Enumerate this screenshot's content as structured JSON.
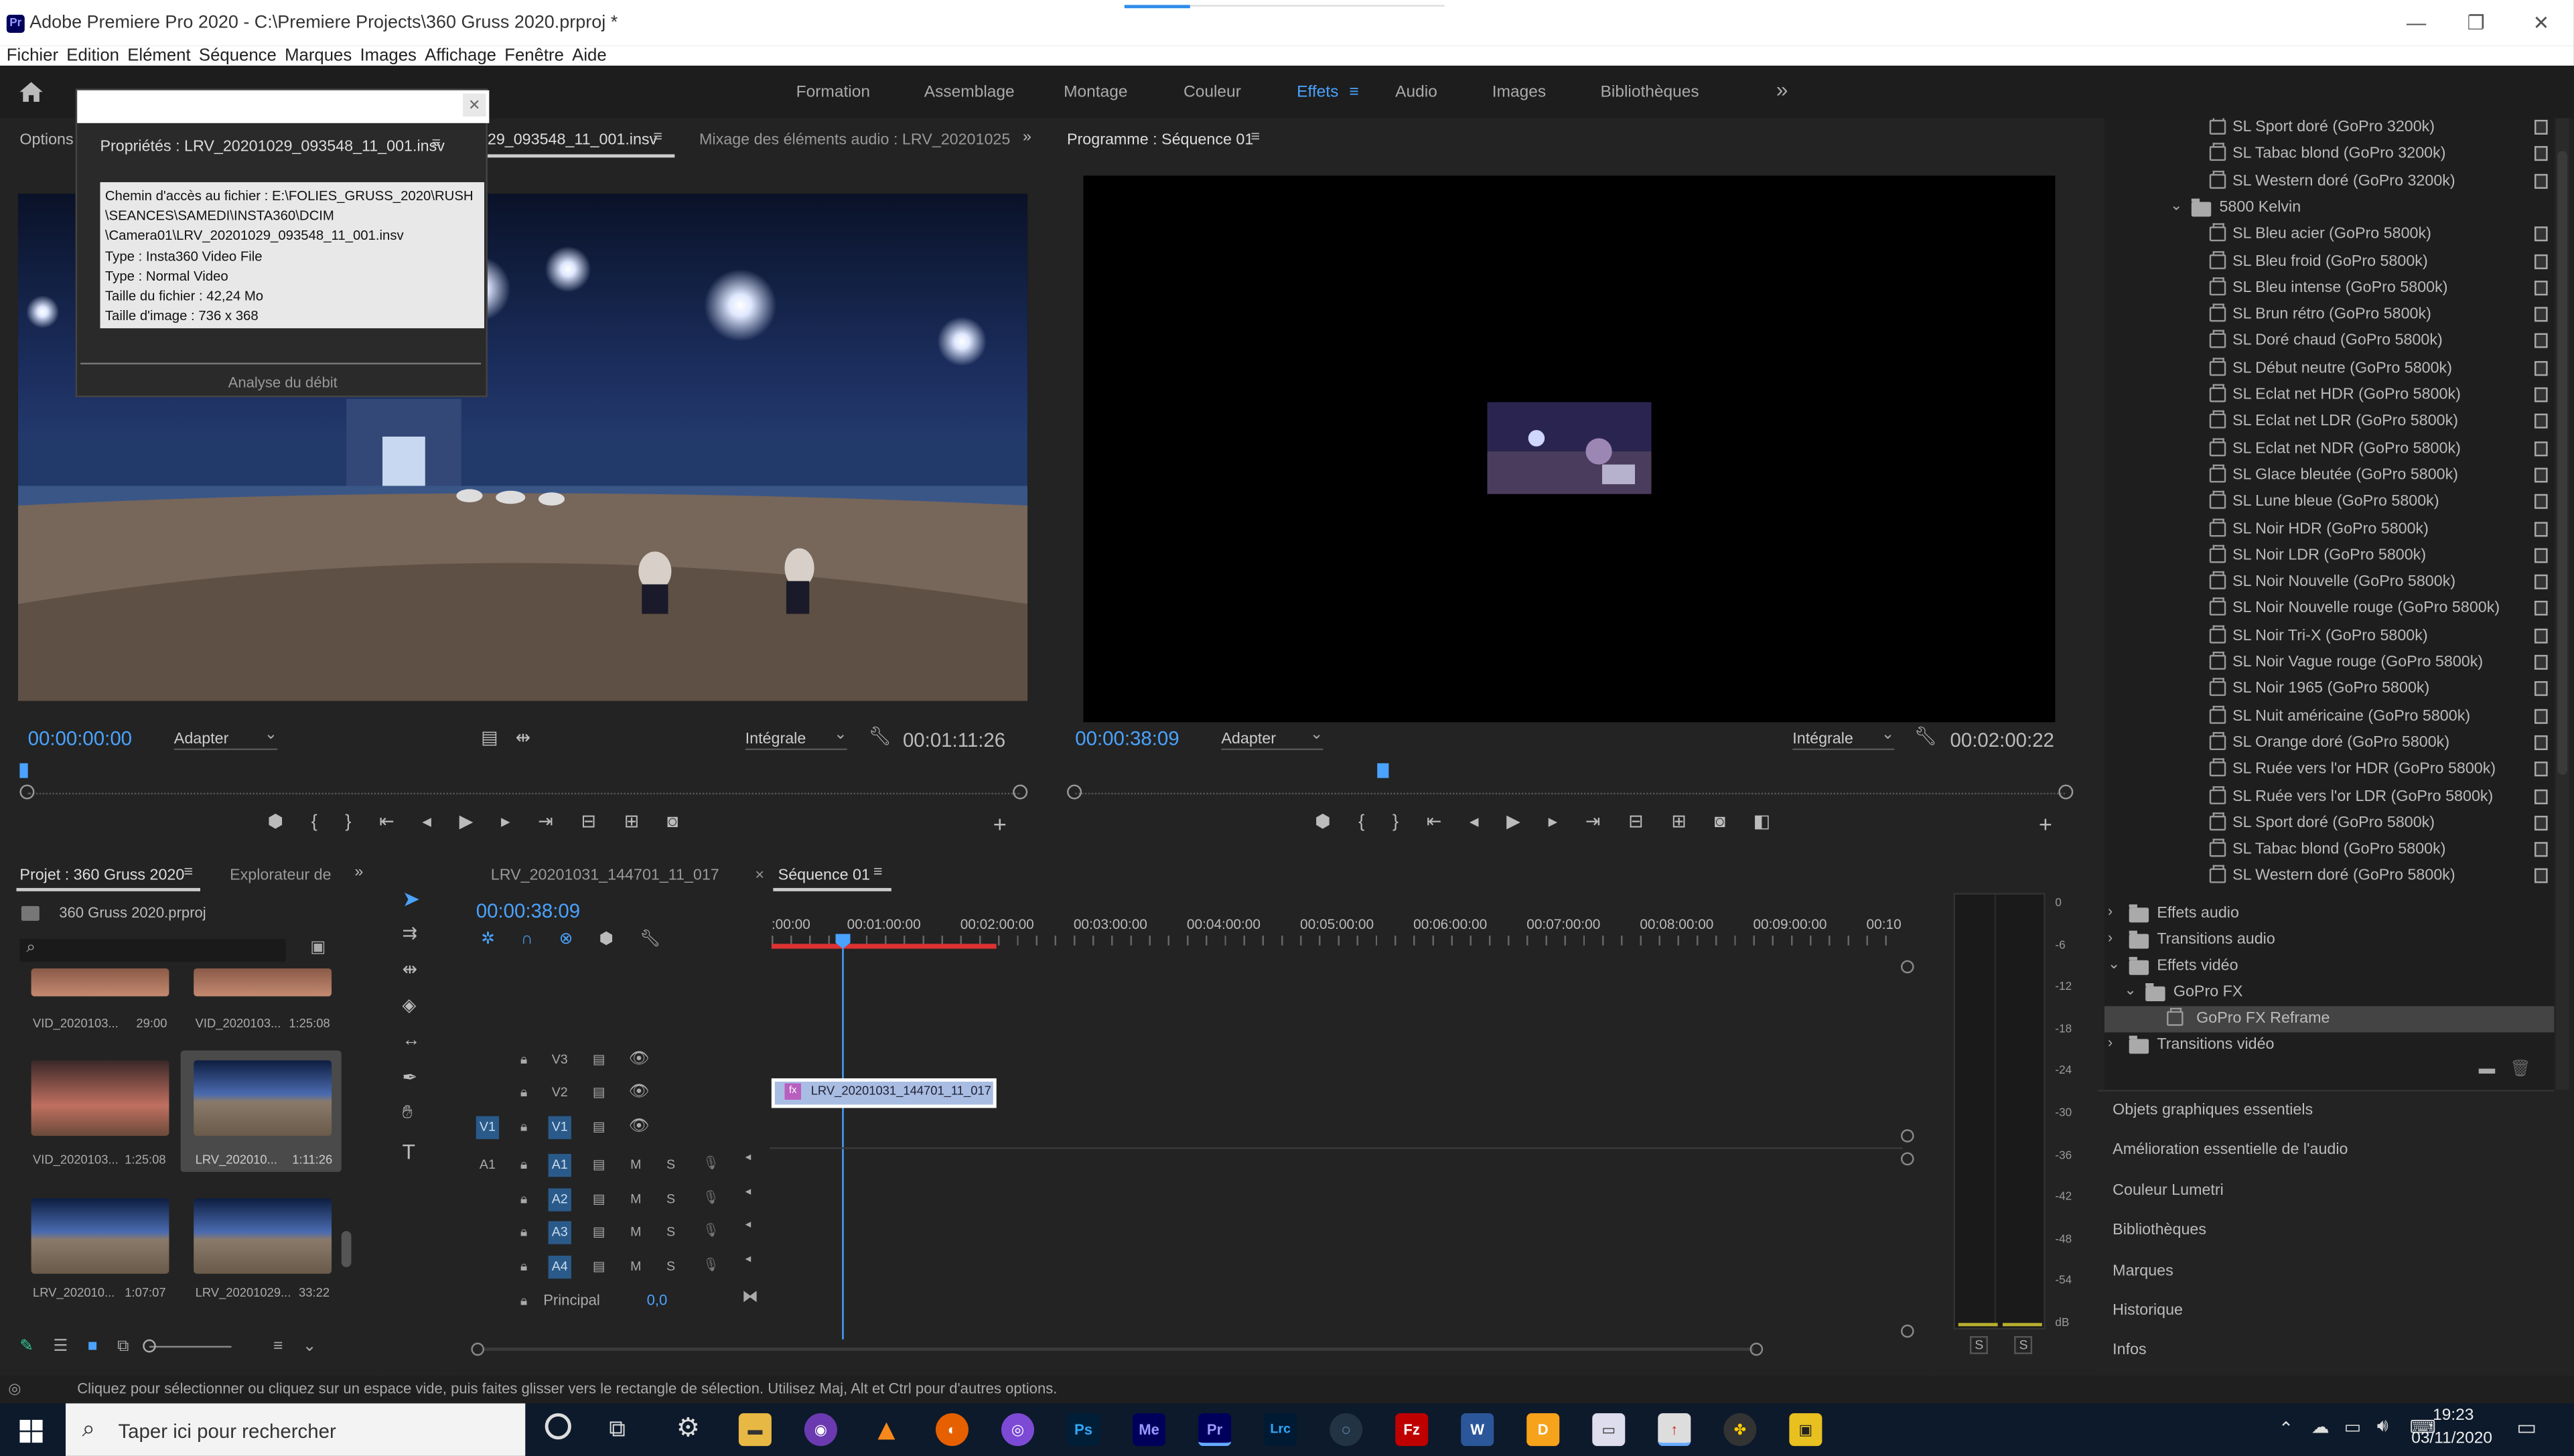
{
  "window": {
    "app": "Adobe Premiere Pro 2020",
    "path": "C:\\Premiere Projects\\360 Gruss 2020.prproj *",
    "minimize": "—",
    "maximize": "❐",
    "close": "✕"
  },
  "menu": [
    "Fichier",
    "Edition",
    "Elément",
    "Séquence",
    "Marques",
    "Images",
    "Affichage",
    "Fenêtre",
    "Aide"
  ],
  "workspaces": [
    "Formation",
    "Assemblage",
    "Montage",
    "Couleur",
    "Effets",
    "Audio",
    "Images",
    "Bibliothèques"
  ],
  "workspace_active": "Effets",
  "workspace_more": "»",
  "source": {
    "options_tab": "Options",
    "props_tab": "Propriétés : LRV_20201029_093548_11_001.insv",
    "source_tab": "29_093548_11_001.insv",
    "mix_tab": "Mixage des éléments audio : LRV_20201025",
    "timecode": "00:00:00:00",
    "fit": "Adapter",
    "quality": "Intégrale",
    "duration": "00:01:11:26"
  },
  "popup": {
    "lines": [
      "Chemin d'accès au fichier : E:\\FOLIES_GRUSS_2020\\RUSH",
      "\\SEANCES\\SAMEDI\\INSTA360\\DCIM",
      "\\Camera01\\LRV_20201029_093548_11_001.insv",
      "Type : Insta360 Video File",
      "Type : Normal Video",
      "Taille du fichier : 42,24 Mo",
      "Taille d'image : 736 x 368"
    ],
    "analysis": "Analyse du débit"
  },
  "program": {
    "tab": "Programme : Séquence 01",
    "timecode": "00:00:38:09",
    "fit": "Adapter",
    "quality": "Intégrale",
    "duration": "00:02:00:22"
  },
  "effects": {
    "items": [
      {
        "label": "SL Sport doré (GoPro 3200k)",
        "kind": "preset"
      },
      {
        "label": "SL Tabac blond (GoPro 3200k)",
        "kind": "preset"
      },
      {
        "label": "SL Western doré (GoPro 3200k)",
        "kind": "preset"
      },
      {
        "label": "5800 Kelvin",
        "kind": "folder"
      },
      {
        "label": "SL Bleu acier (GoPro 5800k)",
        "kind": "preset"
      },
      {
        "label": "SL Bleu froid (GoPro 5800k)",
        "kind": "preset"
      },
      {
        "label": "SL Bleu intense (GoPro 5800k)",
        "kind": "preset"
      },
      {
        "label": "SL Brun rétro (GoPro 5800k)",
        "kind": "preset"
      },
      {
        "label": "SL Doré chaud (GoPro 5800k)",
        "kind": "preset"
      },
      {
        "label": "SL Début neutre (GoPro 5800k)",
        "kind": "preset"
      },
      {
        "label": "SL Eclat net HDR (GoPro 5800k)",
        "kind": "preset"
      },
      {
        "label": "SL Eclat net LDR (GoPro 5800k)",
        "kind": "preset"
      },
      {
        "label": "SL Eclat net NDR (GoPro 5800k)",
        "kind": "preset"
      },
      {
        "label": "SL Glace bleutée (GoPro 5800k)",
        "kind": "preset"
      },
      {
        "label": "SL Lune bleue (GoPro 5800k)",
        "kind": "preset"
      },
      {
        "label": "SL Noir HDR (GoPro 5800k)",
        "kind": "preset"
      },
      {
        "label": "SL Noir LDR (GoPro 5800k)",
        "kind": "preset"
      },
      {
        "label": "SL Noir Nouvelle (GoPro 5800k)",
        "kind": "preset"
      },
      {
        "label": "SL Noir Nouvelle rouge (GoPro 5800k)",
        "kind": "preset"
      },
      {
        "label": "SL Noir Tri-X (GoPro 5800k)",
        "kind": "preset"
      },
      {
        "label": "SL Noir Vague rouge (GoPro 5800k)",
        "kind": "preset"
      },
      {
        "label": "SL Noir 1965 (GoPro 5800k)",
        "kind": "preset"
      },
      {
        "label": "SL Nuit américaine (GoPro 5800k)",
        "kind": "preset"
      },
      {
        "label": "SL Orange doré (GoPro 5800k)",
        "kind": "preset"
      },
      {
        "label": "SL Ruée vers l'or HDR (GoPro 5800k)",
        "kind": "preset"
      },
      {
        "label": "SL Ruée vers l'or LDR (GoPro 5800k)",
        "kind": "preset"
      },
      {
        "label": "SL Sport doré (GoPro 5800k)",
        "kind": "preset"
      },
      {
        "label": "SL Tabac blond (GoPro 5800k)",
        "kind": "preset"
      },
      {
        "label": "SL Western doré (GoPro 5800k)",
        "kind": "preset"
      }
    ],
    "groups": [
      "Effets audio",
      "Transitions audio",
      "Effets vidéo",
      "GoPro FX",
      "GoPro FX Reframe",
      "Transitions vidéo"
    ]
  },
  "right_panels": [
    "Objets graphiques essentiels",
    "Amélioration essentielle de l'audio",
    "Couleur Lumetri",
    "Bibliothèques",
    "Marques",
    "Historique",
    "Infos"
  ],
  "project": {
    "tab": "Projet : 360 Gruss 2020",
    "explorer_tab": "Explorateur de",
    "file": "360 Gruss 2020.prproj",
    "clips": [
      {
        "name": "VID_2020103...",
        "dur": "29:00"
      },
      {
        "name": "VID_2020103...",
        "dur": "1:25:08"
      },
      {
        "name": "VID_2020103...",
        "dur": "1:25:08"
      },
      {
        "name": "LRV_202010...",
        "dur": "1:11:26"
      },
      {
        "name": "LRV_202010...",
        "dur": "1:07:07"
      },
      {
        "name": "LRV_20201029...",
        "dur": "33:22"
      }
    ]
  },
  "timeline": {
    "tab1": "LRV_20201031_144701_11_017",
    "tab2": "Séquence 01",
    "timecode": "00:00:38:09",
    "ruler": [
      ":00:00",
      "00:01:00:00",
      "00:02:00:00",
      "00:03:00:00",
      "00:04:00:00",
      "00:05:00:00",
      "00:06:00:00",
      "00:07:00:00",
      "00:08:00:00",
      "00:09:00:00",
      "00:10"
    ],
    "video_tracks": [
      "V3",
      "V2",
      "V1"
    ],
    "audio_tracks": [
      "A1",
      "A2",
      "A3",
      "A4"
    ],
    "src_v": "V1",
    "src_a": "A1",
    "master": "Principal",
    "master_val": "0,0",
    "clip": "LRV_20201031_144701_11_017",
    "m": "M",
    "s": "S",
    "fx": "fx"
  },
  "meter": {
    "labels": [
      "0",
      "-6",
      "-12",
      "-18",
      "-24",
      "-30",
      "-36",
      "-42",
      "-48",
      "-54",
      "dB"
    ],
    "solo": "S"
  },
  "status": "Cliquez pour sélectionner ou cliquez sur un espace vide, puis faites glisser vers le rectangle de sélection. Utilisez Maj, Alt et Ctrl pour d'autres options.",
  "taskbar": {
    "search": "Taper ici pour rechercher",
    "time": "19:23",
    "date": "03/11/2020",
    "apps": [
      "Ps",
      "Me",
      "Pr",
      "Lrc",
      "Fz"
    ]
  }
}
